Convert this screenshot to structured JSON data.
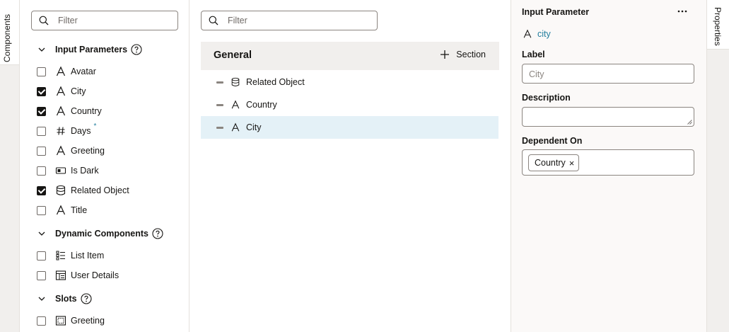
{
  "left_tab": {
    "label": "Components"
  },
  "right_tab": {
    "label": "Properties"
  },
  "components_panel": {
    "filter_placeholder": "Filter",
    "groups": [
      {
        "label": "Input Parameters",
        "items": [
          {
            "label": "Avatar",
            "checked": false,
            "icon": "text-icon"
          },
          {
            "label": "City",
            "checked": true,
            "icon": "text-icon"
          },
          {
            "label": "Country",
            "checked": true,
            "icon": "text-icon"
          },
          {
            "label": "Days",
            "checked": false,
            "icon": "number-icon",
            "marker": "*"
          },
          {
            "label": "Greeting",
            "checked": false,
            "icon": "text-icon"
          },
          {
            "label": "Is Dark",
            "checked": false,
            "icon": "boolean-icon"
          },
          {
            "label": "Related Object",
            "checked": true,
            "icon": "database-icon"
          },
          {
            "label": "Title",
            "checked": false,
            "icon": "text-icon"
          }
        ]
      },
      {
        "label": "Dynamic Components",
        "items": [
          {
            "label": "List Item",
            "checked": false,
            "icon": "list-item-icon"
          },
          {
            "label": "User Details",
            "checked": false,
            "icon": "form-icon"
          }
        ]
      },
      {
        "label": "Slots",
        "items": [
          {
            "label": "Greeting",
            "checked": false,
            "icon": "slot-icon"
          }
        ]
      }
    ]
  },
  "layout_panel": {
    "filter_placeholder": "Filter",
    "section_title": "General",
    "add_section_label": "Section",
    "items": [
      {
        "label": "Related Object",
        "icon": "database-icon",
        "selected": false
      },
      {
        "label": "Country",
        "icon": "text-icon",
        "selected": false
      },
      {
        "label": "City",
        "icon": "text-icon",
        "selected": true
      }
    ]
  },
  "properties_panel": {
    "title": "Input Parameter",
    "param_id": "city",
    "label_field": {
      "label": "Label",
      "placeholder": "City"
    },
    "description_field": {
      "label": "Description",
      "value": ""
    },
    "dependent_field": {
      "label": "Dependent On",
      "chips": [
        "Country"
      ]
    }
  },
  "colors": {
    "accent": "#227e9e",
    "selected_row": "#e4f1f7",
    "section_header": "#f1efed"
  }
}
